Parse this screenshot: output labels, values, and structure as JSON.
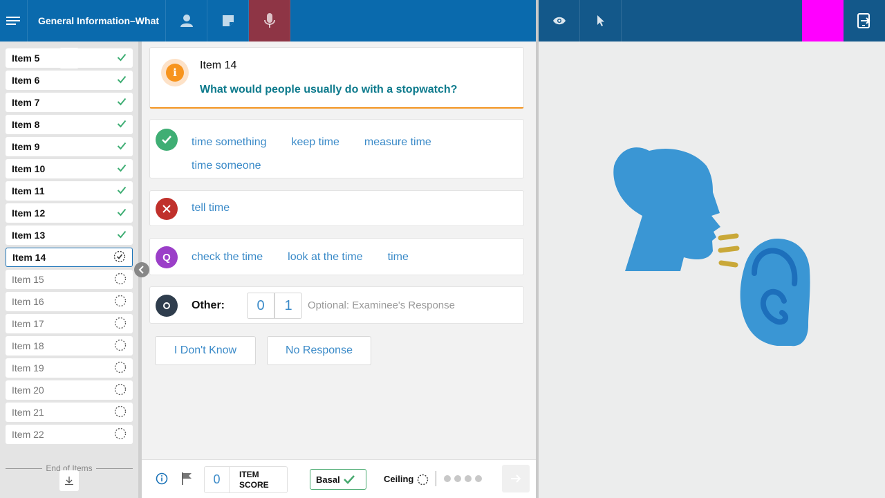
{
  "header": {
    "title": "General Information–What",
    "colors": {
      "left_bar": "#0a6aad",
      "right_bar": "#13588a",
      "mic_active": "#8e3545",
      "magenta_block": "#ff00ff"
    }
  },
  "sidebar": {
    "items": [
      {
        "label": "Item 5",
        "status": "done"
      },
      {
        "label": "Item 6",
        "status": "done"
      },
      {
        "label": "Item 7",
        "status": "done"
      },
      {
        "label": "Item 8",
        "status": "done"
      },
      {
        "label": "Item 9",
        "status": "done"
      },
      {
        "label": "Item 10",
        "status": "done"
      },
      {
        "label": "Item 11",
        "status": "done"
      },
      {
        "label": "Item 12",
        "status": "done"
      },
      {
        "label": "Item 13",
        "status": "done"
      },
      {
        "label": "Item 14",
        "status": "current"
      },
      {
        "label": "Item 15",
        "status": "todo"
      },
      {
        "label": "Item 16",
        "status": "todo"
      },
      {
        "label": "Item 17",
        "status": "todo"
      },
      {
        "label": "Item 18",
        "status": "todo"
      },
      {
        "label": "Item 19",
        "status": "todo"
      },
      {
        "label": "Item 20",
        "status": "todo"
      },
      {
        "label": "Item 21",
        "status": "todo"
      },
      {
        "label": "Item 22",
        "status": "todo"
      }
    ],
    "end_label": "End of Items"
  },
  "question": {
    "item_label": "Item 14",
    "text": "What would people usually do with a stopwatch?"
  },
  "responses": {
    "correct": {
      "icon": "check-icon",
      "color": "#3fae74",
      "words": [
        "time something",
        "keep time",
        "measure time",
        "time someone"
      ]
    },
    "incorrect": {
      "icon": "x-icon",
      "color": "#c0302b",
      "words": [
        "tell time"
      ]
    },
    "query": {
      "icon": "Q",
      "color": "#9b3fc8",
      "words": [
        "check the time",
        "look at the time",
        "time"
      ]
    },
    "other": {
      "icon": "O",
      "color": "#2f3d4d",
      "label": "Other:",
      "score_options": [
        "0",
        "1"
      ],
      "placeholder": "Optional: Examinee's Response"
    }
  },
  "buttons": {
    "dont_know": "I Don't Know",
    "no_response": "No Response"
  },
  "footer": {
    "item_score_value": "0",
    "item_score_label": "ITEM SCORE",
    "basal_label": "Basal",
    "ceiling_label": "Ceiling",
    "progress_dots": 4
  }
}
